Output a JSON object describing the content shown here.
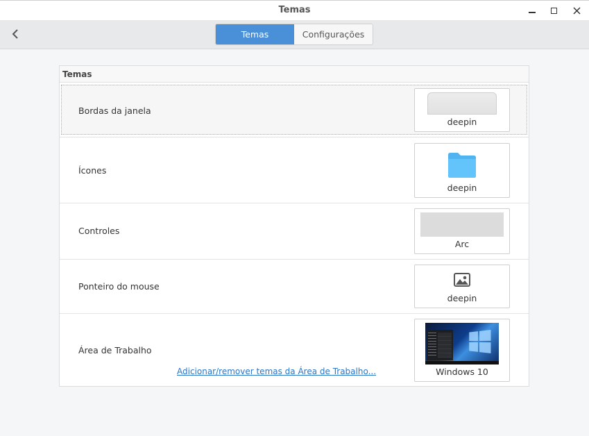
{
  "window": {
    "title": "Temas"
  },
  "header": {
    "tabs": [
      {
        "label": "Temas",
        "active": true
      },
      {
        "label": "Configurações",
        "active": false
      }
    ],
    "accent_color": "#4a90d9"
  },
  "panel": {
    "title": "Temas",
    "rows": [
      {
        "label": "Bordas da janela",
        "value": "deepin",
        "icon": "window-border-preview",
        "selected": true
      },
      {
        "label": "Ícones",
        "value": "deepin",
        "icon": "folder-icon"
      },
      {
        "label": "Controles",
        "value": "Arc",
        "icon": "controls-preview"
      },
      {
        "label": "Ponteiro do mouse",
        "value": "deepin",
        "icon": "image-icon"
      },
      {
        "label": "Área de Trabalho",
        "value": "Windows 10",
        "icon": "desktop-wallpaper-preview"
      }
    ],
    "desktop_link": "Adicionar/remover temas da Área de Trabalho..."
  }
}
